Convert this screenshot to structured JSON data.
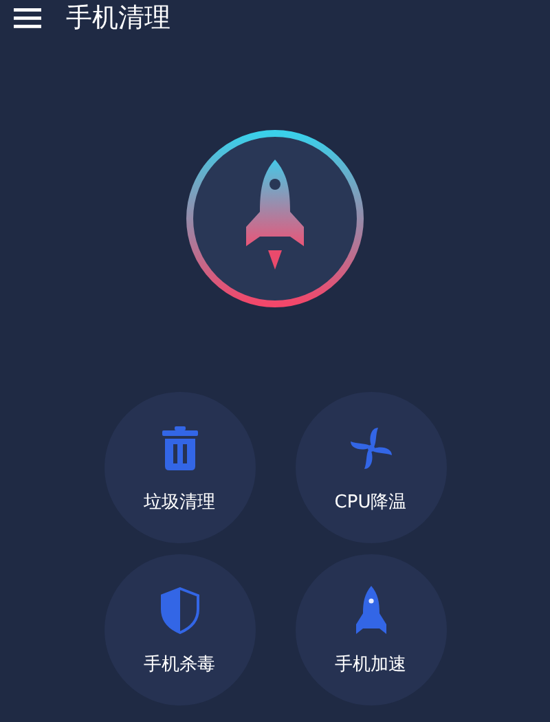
{
  "app_bar": {
    "title": "手机清理"
  },
  "tools": [
    {
      "kind": "trash",
      "label": "垃圾清理"
    },
    {
      "kind": "fan",
      "label": "CPU降温"
    },
    {
      "kind": "shield",
      "label": "手机杀毒"
    },
    {
      "kind": "rocket",
      "label": "手机加速"
    }
  ]
}
